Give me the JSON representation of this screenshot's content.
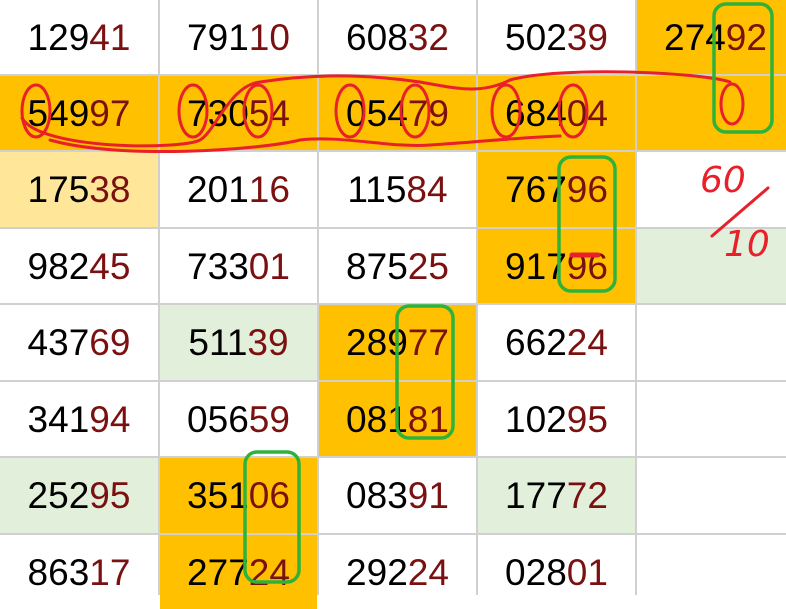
{
  "rows": [
    {
      "cells": [
        {
          "head": "129",
          "tail": "41",
          "bg": "white"
        },
        {
          "head": "791",
          "tail": "10",
          "bg": "white"
        },
        {
          "head": "608",
          "tail": "32",
          "bg": "white"
        },
        {
          "head": "502",
          "tail": "39",
          "bg": "white"
        },
        {
          "head": "274",
          "tail": "92",
          "bg": "orange"
        }
      ]
    },
    {
      "cells": [
        {
          "head": "549",
          "tail": "97",
          "bg": "orange"
        },
        {
          "head": "730",
          "tail": "54",
          "bg": "orange"
        },
        {
          "head": "054",
          "tail": "79",
          "bg": "orange"
        },
        {
          "head": "684",
          "tail": "04",
          "bg": "orange"
        },
        {
          "head": "",
          "tail": "",
          "bg": "orange"
        }
      ]
    },
    {
      "cells": [
        {
          "head": "175",
          "tail": "38",
          "bg": "yellow"
        },
        {
          "head": "201",
          "tail": "16",
          "bg": "white"
        },
        {
          "head": "115",
          "tail": "84",
          "bg": "white"
        },
        {
          "head": "767",
          "tail": "96",
          "bg": "orange"
        },
        {
          "head": "",
          "tail": "",
          "bg": "white"
        }
      ]
    },
    {
      "cells": [
        {
          "head": "982",
          "tail": "45",
          "bg": "white"
        },
        {
          "head": "733",
          "tail": "01",
          "bg": "white"
        },
        {
          "head": "875",
          "tail": "25",
          "bg": "white"
        },
        {
          "head": "917",
          "tail": "96",
          "bg": "orange"
        },
        {
          "head": "",
          "tail": "",
          "bg": "green"
        }
      ]
    },
    {
      "cells": [
        {
          "head": "437",
          "tail": "69",
          "bg": "white"
        },
        {
          "head": "511",
          "tail": "39",
          "bg": "green"
        },
        {
          "head": "289",
          "tail": "77",
          "bg": "orange"
        },
        {
          "head": "662",
          "tail": "24",
          "bg": "white"
        },
        {
          "head": "",
          "tail": "",
          "bg": "white"
        }
      ]
    },
    {
      "cells": [
        {
          "head": "341",
          "tail": "94",
          "bg": "white"
        },
        {
          "head": "056",
          "tail": "59",
          "bg": "white"
        },
        {
          "head": "081",
          "tail": "81",
          "bg": "orange"
        },
        {
          "head": "102",
          "tail": "95",
          "bg": "white"
        },
        {
          "head": "",
          "tail": "",
          "bg": "white"
        }
      ]
    },
    {
      "cells": [
        {
          "head": "252",
          "tail": "95",
          "bg": "green"
        },
        {
          "head": "351",
          "tail": "06",
          "bg": "orange"
        },
        {
          "head": "083",
          "tail": "91",
          "bg": "white"
        },
        {
          "head": "177",
          "tail": "72",
          "bg": "green"
        },
        {
          "head": "",
          "tail": "",
          "bg": "white"
        }
      ]
    },
    {
      "cells": [
        {
          "head": "863",
          "tail": "17",
          "bg": "white"
        },
        {
          "head": "277",
          "tail": "24",
          "bg": "orange"
        },
        {
          "head": "292",
          "tail": "24",
          "bg": "white"
        },
        {
          "head": "028",
          "tail": "01",
          "bg": "white"
        },
        {
          "head": "",
          "tail": "",
          "bg": "white"
        }
      ]
    }
  ],
  "annotations": {
    "handwritten_digit": "0",
    "fraction_top": "60",
    "fraction_bottom": "10",
    "colors": {
      "red_ink": "#e8202a",
      "green_ink": "#2db23a"
    }
  }
}
